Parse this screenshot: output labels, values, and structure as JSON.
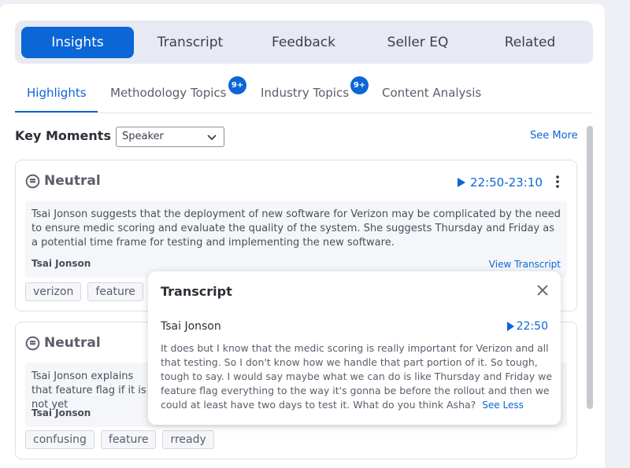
{
  "tabs": [
    {
      "label": "Insights",
      "active": true
    },
    {
      "label": "Transcript",
      "active": false
    },
    {
      "label": "Feedback",
      "active": false
    },
    {
      "label": "Seller EQ",
      "active": false
    },
    {
      "label": "Related",
      "active": false
    }
  ],
  "subtabs": [
    {
      "label": "Highlights",
      "active": true,
      "badge": ""
    },
    {
      "label": "Methodology Topics",
      "active": false,
      "badge": "9+"
    },
    {
      "label": "Industry Topics",
      "active": false,
      "badge": "9+"
    },
    {
      "label": "Content Analysis",
      "active": false,
      "badge": ""
    }
  ],
  "key_moments": {
    "title": "Key Moments",
    "filter_value": "Speaker",
    "see_more": "See More"
  },
  "cards": [
    {
      "sentiment": "Neutral",
      "time_range": "22:50-23:10",
      "summary": "Tsai Jonson suggests that the deployment of new software for Verizon may be complicated by the need to ensure medic scoring and evaluate the quality of the system. She suggests Thursday and Friday as a potential time frame for testing and implementing the new software.",
      "speaker": "Tsai Jonson",
      "view_transcript": "View Transcript",
      "tags": [
        "verizon",
        "feature"
      ]
    },
    {
      "sentiment": "Neutral",
      "summary": "Tsai Jonson explains that feature flag if it is not yet",
      "speaker": "Tsai Jonson",
      "tags": [
        "confusing",
        "feature",
        "rready"
      ]
    }
  ],
  "transcript_popup": {
    "title": "Transcript",
    "speaker": "Tsai Jonson",
    "time": "22:50",
    "text": "It does but I know that the medic scoring is really important for Verizon and all that testing. So I don't know how we handle that part portion of it. So tough, tough to say. I would say maybe what we can do is like Thursday and Friday we feature flag everything to the way it's gonna be before the rollout and then we could at least have two days to test it. What do you think Asha?",
    "see_less": "See Less"
  },
  "colors": {
    "accent": "#0b66d6",
    "tabbar_bg": "#e8eaf3",
    "card_border": "#dde0e6"
  },
  "icons": {
    "sentiment": "neutral-face-icon",
    "play": "play-icon",
    "menu": "kebab-menu-icon",
    "close": "close-icon",
    "dropdown": "chevron-down-icon"
  }
}
